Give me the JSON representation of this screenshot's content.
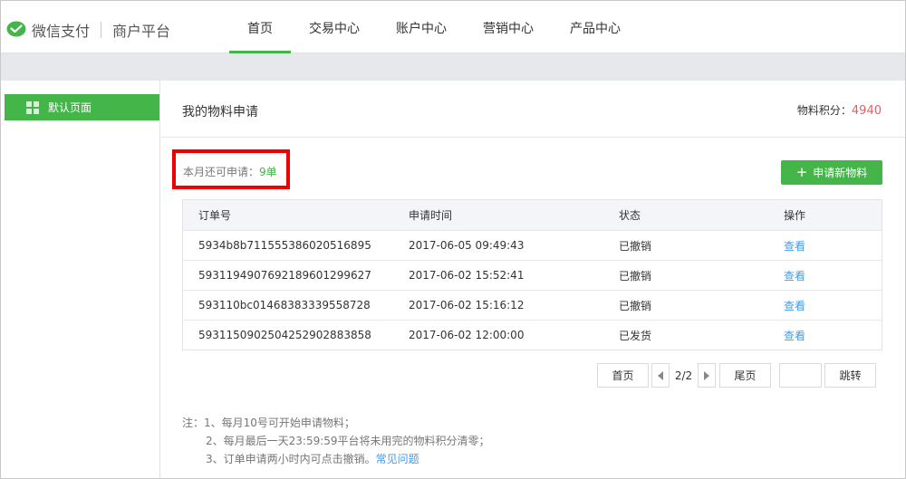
{
  "brand": {
    "name": "微信支付",
    "subtitle": "商户平台",
    "accent_color": "#44b549"
  },
  "nav": {
    "items": [
      "首页",
      "交易中心",
      "账户中心",
      "营销中心",
      "产品中心"
    ],
    "active": "首页"
  },
  "sidebar": {
    "items": [
      {
        "label": "默认页面",
        "icon": "grid-icon",
        "active": true
      }
    ]
  },
  "main": {
    "title": "我的物料申请",
    "points_label": "物料积分：",
    "points_value": "4940",
    "quota_label": "本月还可申请：",
    "quota_value": "9单",
    "apply_button": "申请新物料",
    "table": {
      "columns": [
        "订单号",
        "申请时间",
        "状态",
        "操作"
      ],
      "rows": [
        {
          "order_id": "5934b8b711555386020516895",
          "time": "2017-06-05 09:49:43",
          "status": "已撤销",
          "action": "查看"
        },
        {
          "order_id": "5931194907692189601299627",
          "time": "2017-06-02 15:52:41",
          "status": "已撤销",
          "action": "查看"
        },
        {
          "order_id": "593110bc01468383339558728",
          "time": "2017-06-02 15:16:12",
          "status": "已撤销",
          "action": "查看"
        },
        {
          "order_id": "5931150902504252902883858",
          "time": "2017-06-02 12:00:00",
          "status": "已发货",
          "action": "查看"
        }
      ]
    },
    "pagination": {
      "first": "首页",
      "page": "2/2",
      "last": "尾页",
      "jump": "跳转",
      "input_value": ""
    },
    "notes": {
      "line1": "注：1、每月10号可开始申请物料；",
      "line2": "2、每月最后一天23:59:59平台将未用完的物料积分清零；",
      "line3": "3、订单申请两小时内可点击撤销。",
      "faq_link": "常见问题"
    },
    "highlight_color": "#ee0000"
  }
}
